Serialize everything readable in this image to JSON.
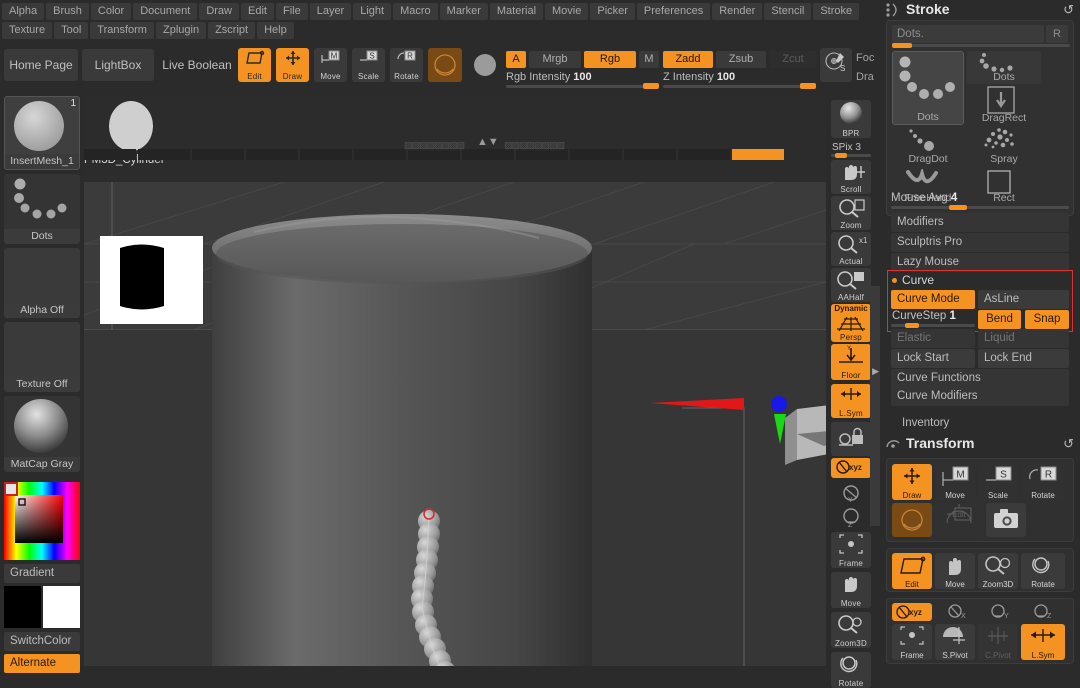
{
  "app": {
    "name": "ZBrush"
  },
  "menubar": {
    "items": [
      "Alpha",
      "Brush",
      "Color",
      "Document",
      "Draw",
      "Edit",
      "File",
      "Layer",
      "Light",
      "Macro",
      "Marker",
      "Material",
      "Movie",
      "Picker",
      "Preferences",
      "Render",
      "Stencil",
      "Stroke",
      "Texture",
      "Tool",
      "Transform",
      "Zplugin",
      "Zscript",
      "Help"
    ]
  },
  "toolbar": {
    "home_page": "Home Page",
    "lightbox": "LightBox",
    "live_boolean": "Live Boolean",
    "edit": "Edit",
    "draw": "Draw",
    "move": "Move",
    "scale": "Scale",
    "rotate": "Rotate",
    "color_a": "A",
    "mrgb": "Mrgb",
    "rgb": "Rgb",
    "m": "M",
    "zadd": "Zadd",
    "zsub": "Zsub",
    "zcut": "Zcut",
    "rgb_intensity_label": "Rgb Intensity",
    "rgb_intensity_value": "100",
    "z_intensity_label": "Z Intensity",
    "z_intensity_value": "100",
    "focal_shift_label": "Foc",
    "draw_size_label": "Dra"
  },
  "left_sidebar": {
    "items": [
      {
        "label": "InsertMesh_1",
        "badge": "1",
        "kind": "brush"
      },
      {
        "label": "Dots",
        "kind": "stroke"
      },
      {
        "label": "Alpha Off",
        "kind": "alpha"
      },
      {
        "label": "Texture Off",
        "kind": "texture"
      },
      {
        "label": "MatCap Gray",
        "kind": "material"
      },
      {
        "label": "Gradient",
        "kind": "gradient"
      },
      {
        "label": "SwitchColor",
        "kind": "switchcolor"
      },
      {
        "label": "Alternate",
        "kind": "alternate"
      }
    ]
  },
  "tool_shelf": {
    "current_tool": "PM3D_Cylinder"
  },
  "canvas": {
    "gizmo": {
      "x_axis_color": "#e01818",
      "y_axis_color": "#18d818",
      "z_axis_color": "#1818e8"
    },
    "alpha_thumb_bg": "#ffffff",
    "mesh_name": "PM3D_Cylinder",
    "curve_start_marker_color": "#d03030"
  },
  "rail": {
    "items": [
      {
        "label": "BPR",
        "kind": "bpr",
        "active": false
      },
      {
        "label": "SPix",
        "value": "3",
        "kind": "slider"
      },
      {
        "label": "Scroll",
        "kind": "scroll",
        "active": false
      },
      {
        "label": "Zoom",
        "kind": "zoom",
        "active": false
      },
      {
        "label": "Actual",
        "kind": "actual",
        "active": false
      },
      {
        "label": "AAHalf",
        "kind": "aahalf",
        "active": false
      },
      {
        "label": "Persp",
        "sublabel": "Dynamic",
        "kind": "persp",
        "active": true
      },
      {
        "label": "Floor",
        "kind": "floor",
        "active": true
      },
      {
        "label": "L.Sym",
        "kind": "lsym",
        "active": true
      },
      {
        "label": "",
        "kind": "lock",
        "active": false
      },
      {
        "label": "Xyz",
        "kind": "xyz",
        "active": true
      },
      {
        "label": "",
        "kind": "rot-y",
        "active": false
      },
      {
        "label": "",
        "kind": "rot-z",
        "active": false
      },
      {
        "label": "Frame",
        "kind": "frame",
        "active": false
      },
      {
        "label": "Move",
        "kind": "move",
        "active": false
      },
      {
        "label": "Zoom3D",
        "kind": "zoom3d",
        "active": false
      },
      {
        "label": "Rotate",
        "kind": "rotate",
        "active": false
      }
    ]
  },
  "stroke_palette": {
    "title": "Stroke",
    "preset_name": "Dots.",
    "preset_r_button": "R",
    "current_swatch": "Dots",
    "swatches": [
      {
        "label": "Dots",
        "selected": true
      },
      {
        "label": "Dots",
        "selected": false
      },
      {
        "label": "DragRect",
        "selected": false
      },
      {
        "label": "DragDot",
        "selected": false
      },
      {
        "label": "Spray",
        "selected": false
      },
      {
        "label": "FreeHand",
        "selected": false
      },
      {
        "label": "Rect",
        "selected": false
      }
    ],
    "mouse_avg_label": "Mouse Avg",
    "mouse_avg_value": "4",
    "rows": [
      {
        "label": "Modifiers"
      },
      {
        "label": "Sculptris Pro"
      },
      {
        "label": "Lazy Mouse"
      }
    ],
    "curve_section": {
      "title": "Curve",
      "highlighted": true,
      "highlight_color": "#e03030",
      "curve_mode": {
        "label": "Curve Mode",
        "active": true
      },
      "as_line": {
        "label": "AsLine",
        "active": false
      },
      "curve_step": {
        "label": "CurveStep",
        "value": "1"
      },
      "bend": {
        "label": "Bend",
        "active": true
      },
      "snap": {
        "label": "Snap",
        "active": true
      }
    },
    "after_curve_rows": [
      {
        "label": "Elastic",
        "active": false,
        "dim": true
      },
      {
        "label": "Liquid",
        "active": false,
        "dim": true
      },
      {
        "label": "Lock Start",
        "active": false
      },
      {
        "label": "Lock End",
        "active": false
      }
    ],
    "footer_rows": [
      {
        "label": "Curve Functions"
      },
      {
        "label": "Curve Modifiers"
      }
    ]
  },
  "inventory": {
    "label": "Inventory"
  },
  "transform_palette": {
    "title": "Transform",
    "row1": [
      {
        "label": "Draw",
        "active": true
      },
      {
        "label": "Move",
        "active": false
      },
      {
        "label": "Scale",
        "active": false
      },
      {
        "label": "Rotate",
        "active": false
      }
    ],
    "row2": [
      {
        "label": "",
        "kind": "gyro",
        "active": true
      },
      {
        "label": "Edit",
        "kind": "edit-obj",
        "active": false,
        "dim": true
      },
      {
        "label": "",
        "kind": "camera",
        "active": false
      }
    ],
    "row3": [
      {
        "label": "Edit",
        "active": true
      },
      {
        "label": "Move",
        "active": false
      },
      {
        "label": "Zoom3D",
        "active": false
      },
      {
        "label": "Rotate",
        "active": false
      }
    ],
    "row4": [
      {
        "label": "Xyz",
        "active": true
      },
      {
        "label": "X",
        "active": false
      },
      {
        "label": "Y",
        "active": false
      },
      {
        "label": "Z",
        "active": false
      }
    ],
    "row5": [
      {
        "label": "Frame",
        "active": false
      },
      {
        "label": "S.Pivot",
        "active": false
      },
      {
        "label": "C.Pivot",
        "active": false,
        "dim": true
      },
      {
        "label": "L.Sym",
        "active": true
      }
    ]
  },
  "colors": {
    "accent": "#f59322",
    "panel_bg": "#2b2b2b",
    "canvas_bg": "#3b3b3b",
    "highlight_red": "#e03030"
  }
}
